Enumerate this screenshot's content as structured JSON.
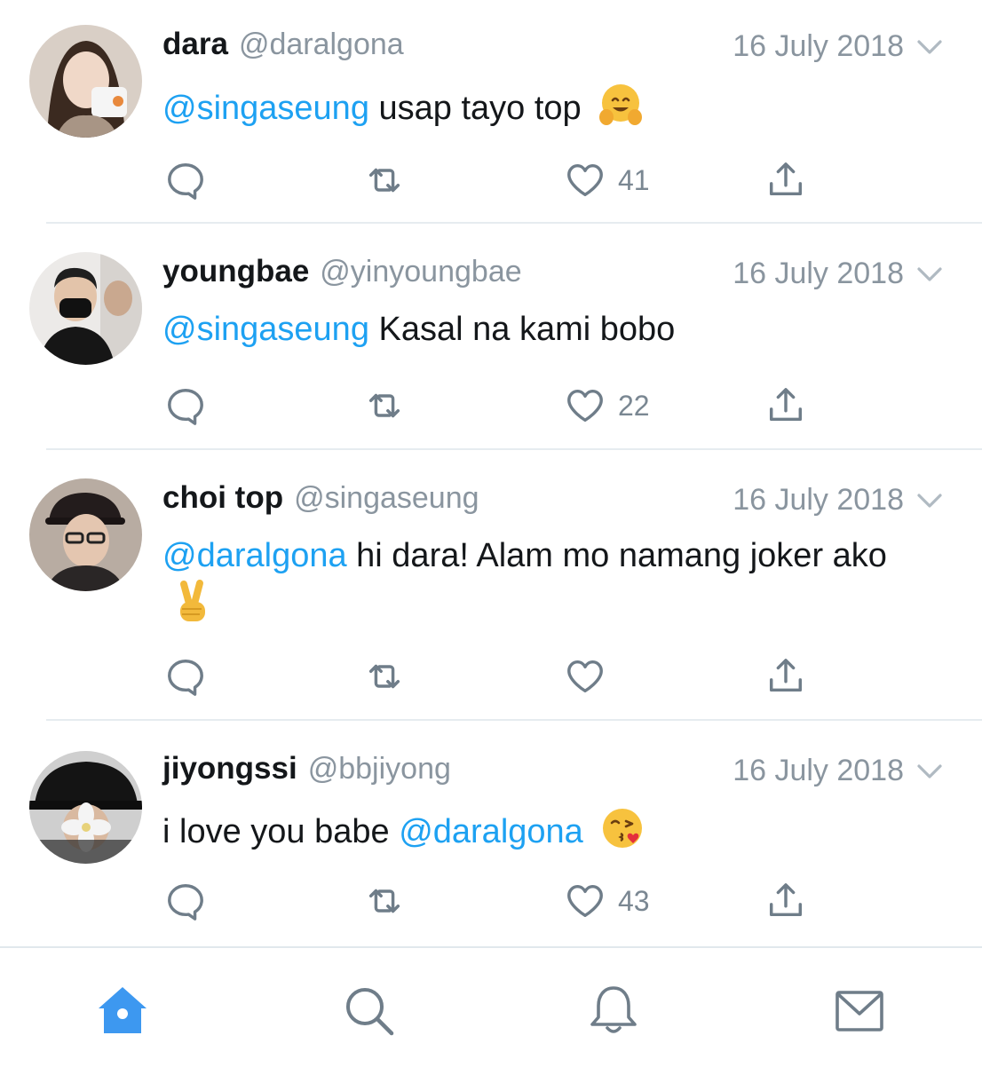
{
  "tweets": [
    {
      "name": "dara",
      "handle": "@daralgona",
      "date": "16 July 2018",
      "mention": "@singaseung",
      "text": " usap tayo top",
      "emoji": "hugging-face-emoji",
      "likes": "41"
    },
    {
      "name": "youngbae",
      "handle": "@yinyoungbae",
      "date": "16 July 2018",
      "mention": "@singaseung",
      "text": " Kasal na kami bobo",
      "likes": "22"
    },
    {
      "name": "choi top",
      "handle": "@singaseung",
      "date": "16 July 2018",
      "mention": "@daralgona",
      "text": " hi dara! Alam mo namang joker ako",
      "emoji": "victory-hand-emoji",
      "likes": ""
    },
    {
      "name": "jiyongssi",
      "handle": "@bbjiyong",
      "date": "16 July 2018",
      "text_before": "i love you babe ",
      "mention": "@daralgona",
      "emoji": "kissing-face-emoji",
      "likes": "43"
    }
  ],
  "icons": {
    "reply": "reply-icon",
    "retweet": "retweet-icon",
    "like": "heart-icon",
    "share": "share-icon",
    "caret": "chevron-down-icon"
  },
  "tabs": [
    "home-icon",
    "search-icon",
    "notifications-icon",
    "messages-icon"
  ],
  "colors": {
    "accent": "#1da1f2",
    "active_tab": "#3d98f0",
    "muted": "#8a959f",
    "icon": "#6f7d89",
    "separator": "#e6ecf0"
  }
}
